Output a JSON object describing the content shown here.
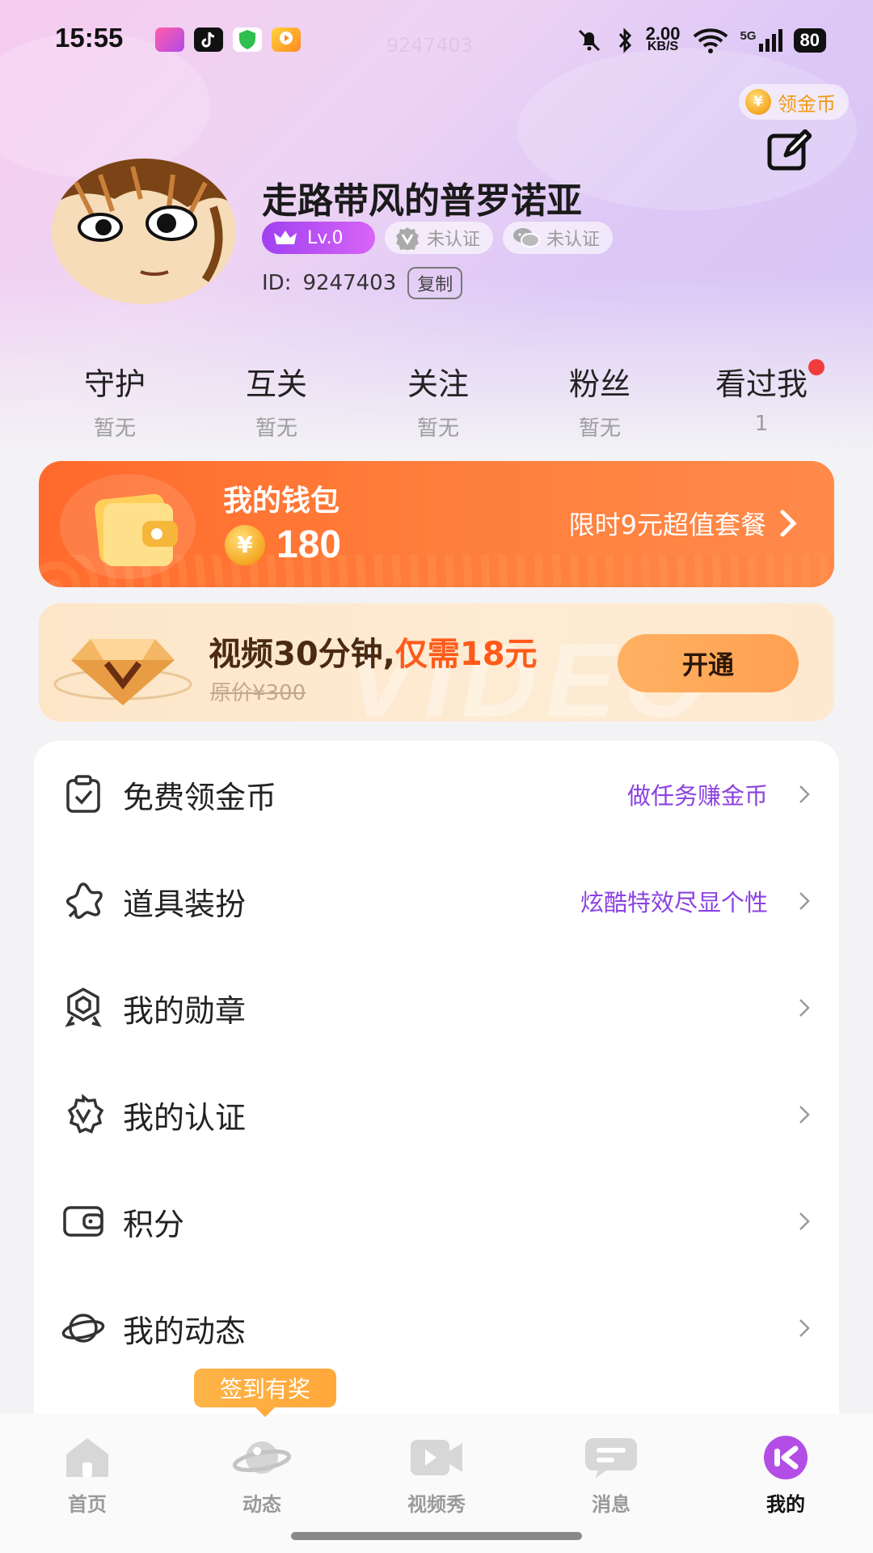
{
  "status_bar": {
    "time": "15:55",
    "net_speed_value": "2.00",
    "net_speed_unit": "KB/S",
    "network": "5G",
    "battery": "80",
    "ghost_id": "9247403"
  },
  "header": {
    "gold_pill_label": "领金币",
    "coin_symbol": "¥"
  },
  "profile": {
    "username": "走路带风的普罗诺亚",
    "level": "Lv.0",
    "verify_badge": "未认证",
    "wechat_badge": "未认证",
    "id_label": "ID:",
    "id_value": "9247403",
    "copy_label": "复制"
  },
  "stats": [
    {
      "label": "守护",
      "value": "暂无"
    },
    {
      "label": "互关",
      "value": "暂无"
    },
    {
      "label": "关注",
      "value": "暂无"
    },
    {
      "label": "粉丝",
      "value": "暂无"
    },
    {
      "label": "看过我",
      "value": "1"
    }
  ],
  "wallet": {
    "title": "我的钱包",
    "balance": "180",
    "promo": "限时9元超值套餐"
  },
  "vip": {
    "title_main": "视频30分钟,",
    "title_highlight": "仅需18元",
    "original_price": "原价¥300",
    "button": "开通",
    "watermark": "VIDEO"
  },
  "menu": [
    {
      "label": "免费领金币",
      "hint": "做任务赚金币",
      "icon": "clipboard-check-icon"
    },
    {
      "label": "道具装扮",
      "hint": "炫酷特效尽显个性",
      "icon": "star-flower-icon"
    },
    {
      "label": "我的勋章",
      "hint": "",
      "icon": "medal-icon"
    },
    {
      "label": "我的认证",
      "hint": "",
      "icon": "verified-v-icon"
    },
    {
      "label": "积分",
      "hint": "",
      "icon": "wallet-icon"
    },
    {
      "label": "我的动态",
      "hint": "",
      "icon": "planet-icon"
    }
  ],
  "signin_tip": "签到有奖",
  "tabs": [
    {
      "label": "首页",
      "icon": "home-icon"
    },
    {
      "label": "动态",
      "icon": "planet-icon"
    },
    {
      "label": "视频秀",
      "icon": "video-icon"
    },
    {
      "label": "消息",
      "icon": "message-icon"
    },
    {
      "label": "我的",
      "icon": "me-icon"
    }
  ],
  "colors": {
    "accent_purple": "#8b42e0",
    "wallet_orange": "#ff6a2c",
    "vip_button": "#ffa052",
    "gold": "#f29a12"
  }
}
